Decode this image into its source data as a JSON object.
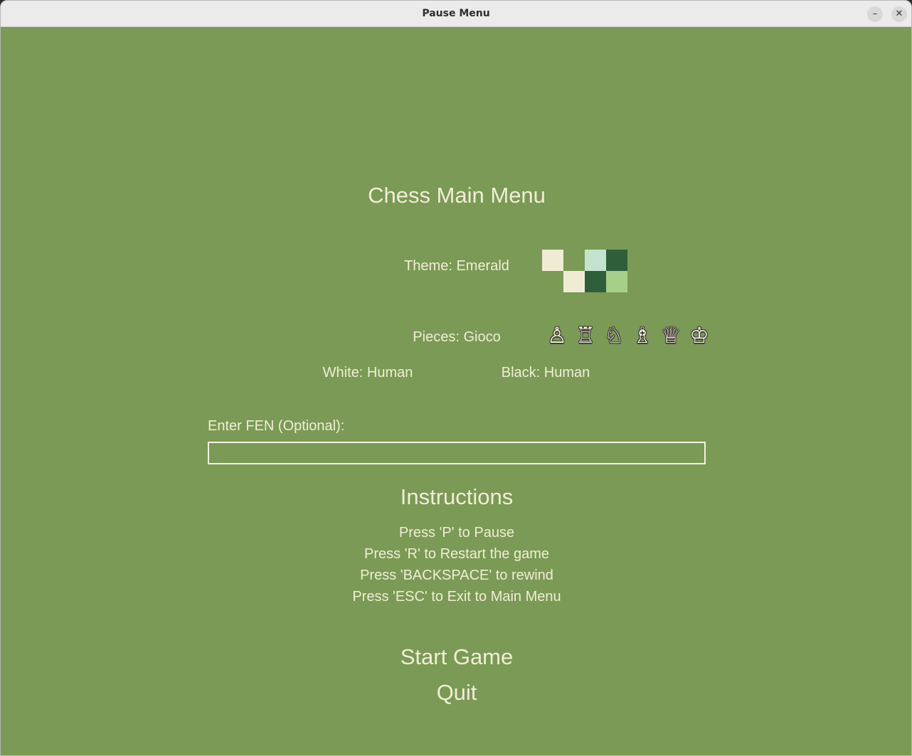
{
  "window": {
    "title": "Pause Menu",
    "minimize_label": "–",
    "close_label": "✕"
  },
  "menu": {
    "title": "Chess Main Menu",
    "theme_label": "Theme: Emerald",
    "theme_colors": {
      "light": "#f0ecd4",
      "mint": "#c3e3cf",
      "dark": "#2f5f3a",
      "pale_green": "#a6d08a"
    },
    "pieces_label": "Pieces: Gioco",
    "pieces_icons": [
      "pawn-icon",
      "rook-icon",
      "knight-icon",
      "bishop-icon",
      "queen-icon",
      "king-icon"
    ],
    "white_player": "White: Human",
    "black_player": "Black: Human",
    "fen_label": "Enter FEN (Optional):",
    "fen_value": "",
    "fen_placeholder": "",
    "instructions_title": "Instructions",
    "instructions": [
      "Press 'P' to Pause",
      "Press 'R' to Restart the game",
      "Press 'BACKSPACE' to rewind",
      "Press 'ESC' to Exit to Main Menu"
    ],
    "start_label": "Start Game",
    "quit_label": "Quit"
  },
  "colors": {
    "background": "#7a9a56",
    "text": "#f2edd6"
  }
}
